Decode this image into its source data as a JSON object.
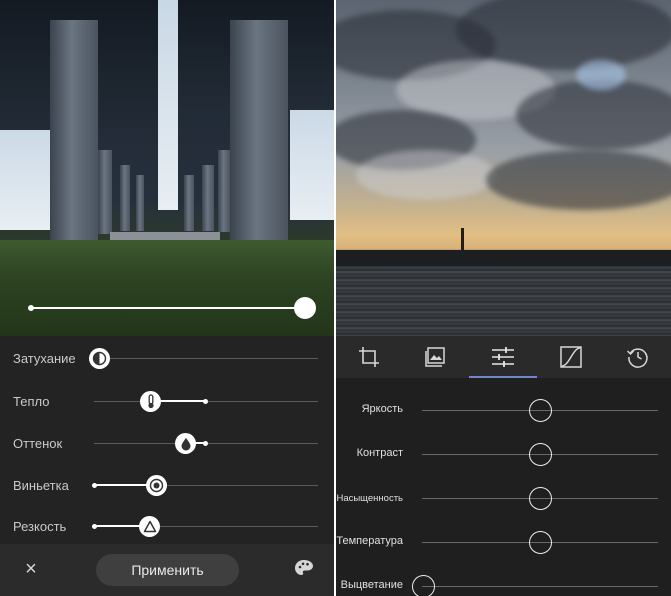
{
  "left_panel": {
    "preview_slider": {
      "value": 1.0
    },
    "adjustments": [
      {
        "label": "Затухание",
        "value": 0.0,
        "icon": "contrast-half-icon"
      },
      {
        "label": "Тепло",
        "value": 0.5,
        "icon": "thermometer-icon"
      },
      {
        "label": "Оттенок",
        "value": 0.5,
        "icon": "drop-icon"
      },
      {
        "label": "Виньетка",
        "value": 0.25,
        "icon": "vignette-icon"
      },
      {
        "label": "Резкость",
        "value": 0.25,
        "icon": "triangle-icon"
      }
    ],
    "bottom_bar": {
      "close_icon": "×",
      "apply_label": "Применить",
      "palette_icon": "palette-icon"
    }
  },
  "right_panel": {
    "tools": [
      {
        "name": "crop-icon",
        "active": false
      },
      {
        "name": "image-icon",
        "active": false
      },
      {
        "name": "sliders-icon",
        "active": true
      },
      {
        "name": "curves-icon",
        "active": false
      },
      {
        "name": "history-icon",
        "active": false
      }
    ],
    "accent_color": "#6f86c8",
    "adjustments": [
      {
        "label": "Яркость",
        "value": 0.5
      },
      {
        "label": "Контраст",
        "value": 0.5
      },
      {
        "label": "Насыщенность",
        "value": 0.5
      },
      {
        "label": "Температура",
        "value": 0.5
      },
      {
        "label": "Выцветание",
        "value": 0.0
      }
    ]
  }
}
